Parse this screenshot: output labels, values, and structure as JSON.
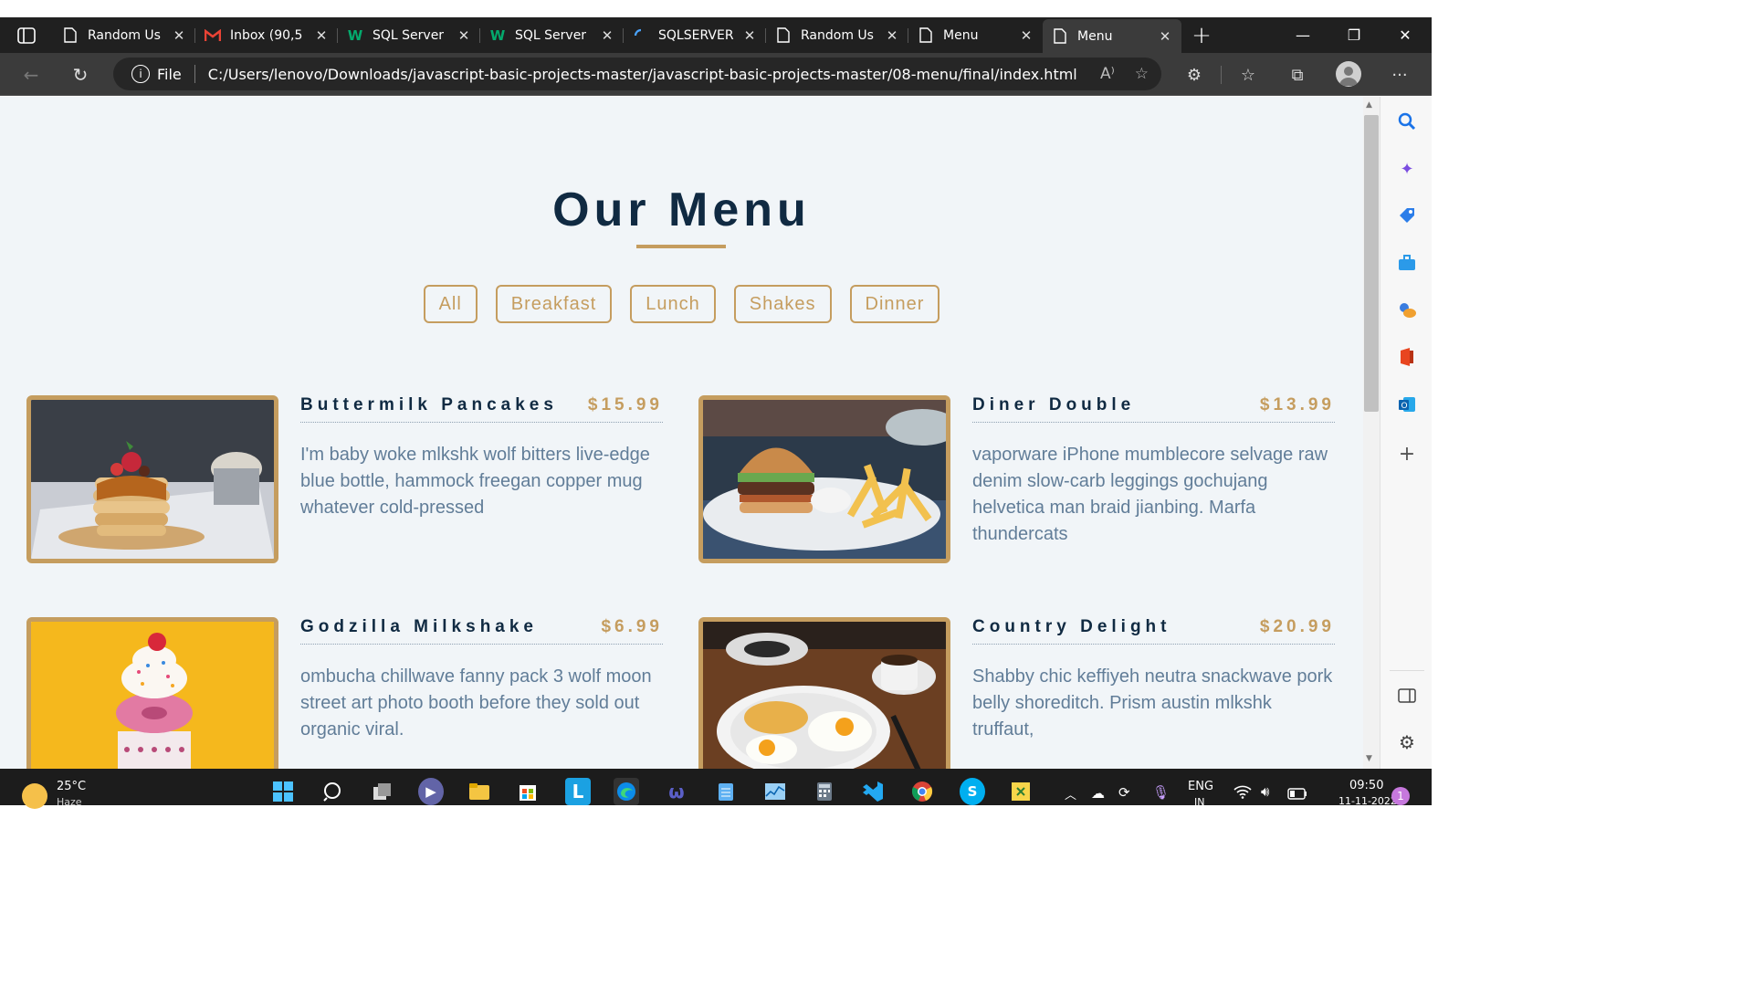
{
  "browser": {
    "tabs": [
      {
        "label": "Random Us",
        "icon": "page-icon"
      },
      {
        "label": "Inbox (90,5",
        "icon": "gmail-icon"
      },
      {
        "label": "SQL Server",
        "icon": "w3schools-icon"
      },
      {
        "label": "SQL Server",
        "icon": "w3schools-icon"
      },
      {
        "label": "SQLSERVER",
        "icon": "loading-icon"
      },
      {
        "label": "Random Us",
        "icon": "page-icon"
      },
      {
        "label": "Menu",
        "icon": "page-icon"
      },
      {
        "label": "Menu",
        "icon": "page-icon",
        "active": true
      }
    ],
    "address": {
      "scheme_label": "File",
      "url": "C:/Users/lenovo/Downloads/javascript-basic-projects-master/javascript-basic-projects-master/08-menu/final/index.html"
    }
  },
  "page": {
    "title": "Our Menu",
    "filters": [
      "All",
      "Breakfast",
      "Lunch",
      "Shakes",
      "Dinner"
    ],
    "items": [
      {
        "name": "Buttermilk Pancakes",
        "price": "$15.99",
        "desc": "I'm baby woke mlkshk wolf bitters live-edge blue bottle, hammock freegan copper mug whatever cold-pressed"
      },
      {
        "name": "Diner Double",
        "price": "$13.99",
        "desc": "vaporware iPhone mumblecore selvage raw denim slow-carb leggings gochujang helvetica man braid jianbing. Marfa thundercats"
      },
      {
        "name": "Godzilla Milkshake",
        "price": "$6.99",
        "desc": "ombucha chillwave fanny pack 3 wolf moon street art photo booth before they sold out organic viral."
      },
      {
        "name": "Country Delight",
        "price": "$20.99",
        "desc": "Shabby chic keffiyeh neutra snackwave pork belly shoreditch. Prism austin mlkshk truffaut,"
      }
    ],
    "colors": {
      "accent": "#c59d5f",
      "heading": "#102a42",
      "text": "#617d98",
      "background": "#f1f5f8"
    }
  },
  "taskbar": {
    "weather_temp": "25°C",
    "weather_text": "Haze",
    "lang": "ENG",
    "lang_region": "IN",
    "time": "09:50",
    "date": "11-11-2022",
    "notification_count": "1"
  }
}
